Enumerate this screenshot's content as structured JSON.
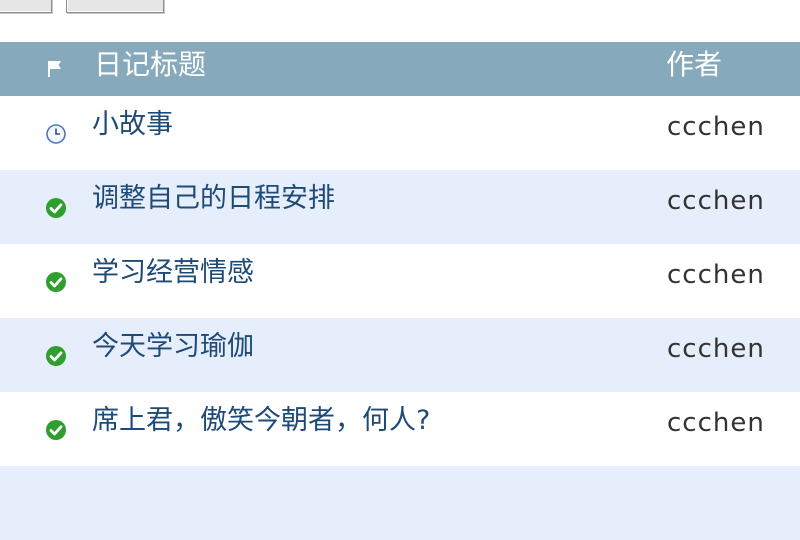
{
  "header": {
    "title_col": "日记标题",
    "author_col": "作者"
  },
  "rows": [
    {
      "title": "小故事",
      "author": "ccchen",
      "status": "clock-icon"
    },
    {
      "title": "调整自己的日程安排",
      "author": "ccchen",
      "status": "check-icon"
    },
    {
      "title": "学习经营情感",
      "author": "ccchen",
      "status": "check-icon"
    },
    {
      "title": "今天学习瑜伽",
      "author": "ccchen",
      "status": "check-icon"
    },
    {
      "title": "席上君，傲笑今朝者，何人?",
      "author": "ccchen",
      "status": "check-icon"
    }
  ],
  "colors": {
    "header_bg": "#86a9bb",
    "alt_row_bg": "#e6eefb",
    "title_text": "#1e4a78",
    "check_green": "#2e9e2e"
  }
}
